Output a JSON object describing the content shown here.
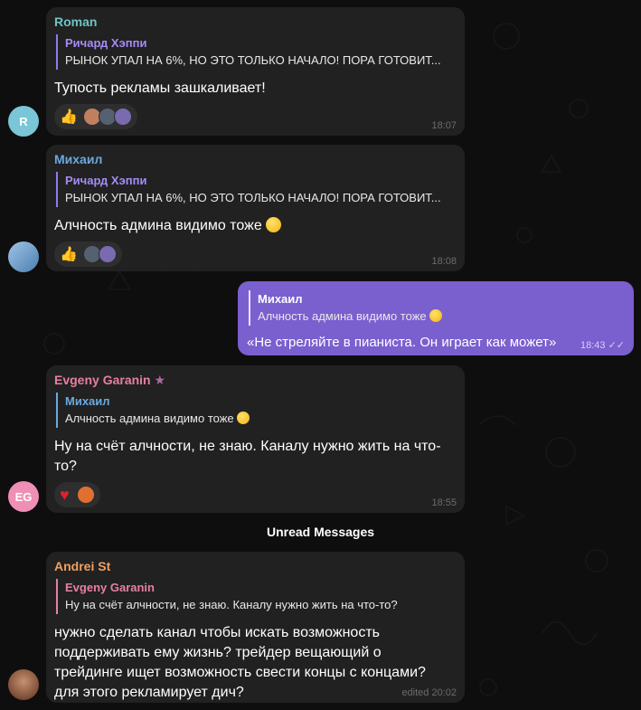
{
  "messages": [
    {
      "sender": "Roman",
      "sender_color": "#6fc3c3",
      "avatar_text": "R",
      "avatar_color": "#7ac6d6",
      "reply_name": "Ричард Хэппи",
      "reply_text": "РЫНОК УПАЛ НА 6%, НО ЭТО ТОЛЬКО НАЧАЛО! ПОРА ГОТОВИТ...",
      "text": "Тупость рекламы зашкаливает!",
      "reaction": "👍",
      "time": "18:07"
    },
    {
      "sender": "Михаил",
      "sender_color": "#6aa9e0",
      "reply_name": "Ричард Хэппи",
      "reply_text": "РЫНОК УПАЛ НА 6%, НО ЭТО ТОЛЬКО НАЧАЛО! ПОРА ГОТОВИТ...",
      "text": "Алчность админа видимо тоже",
      "reaction": "👍",
      "time": "18:08"
    },
    {
      "sender": "Михаил",
      "reply_text": "Алчность админа видимо тоже",
      "text": "«Не стреляйте в пианиста. Он играет как может»",
      "time": "18:43"
    },
    {
      "sender": "Evgeny Garanin",
      "sender_color": "#e77fa3",
      "avatar_text": "EG",
      "avatar_color": "#f08fb5",
      "reply_name": "Михаил",
      "reply_text": "Алчность админа видимо тоже",
      "text": "Ну на счёт алчности, не знаю. Каналу нужно жить на что-то?",
      "reaction": "♥",
      "time": "18:55"
    },
    {
      "sender": "Andrei St",
      "sender_color": "#f0a060",
      "reply_name": "Evgeny Garanin",
      "reply_text": "Ну на счёт алчности, не знаю. Каналу нужно жить на что-то?",
      "text": "нужно сделать канал чтобы искать возможность поддерживать ему жизнь? трейдер вещающий о трейдинге ищет возможность свести концы с концами? для этого рекламирует дич?",
      "time": "edited 20:02"
    }
  ],
  "unread_divider": "Unread Messages",
  "colors": {
    "incoming_bubble": "#212121",
    "outgoing_bubble": "#7a5fcf",
    "reply_bar_violet": "#8e7bf0"
  },
  "icons": [
    "thumbs-up-icon",
    "heart-icon",
    "smile-emoji-icon",
    "star-badge-icon",
    "double-check-icon"
  ]
}
